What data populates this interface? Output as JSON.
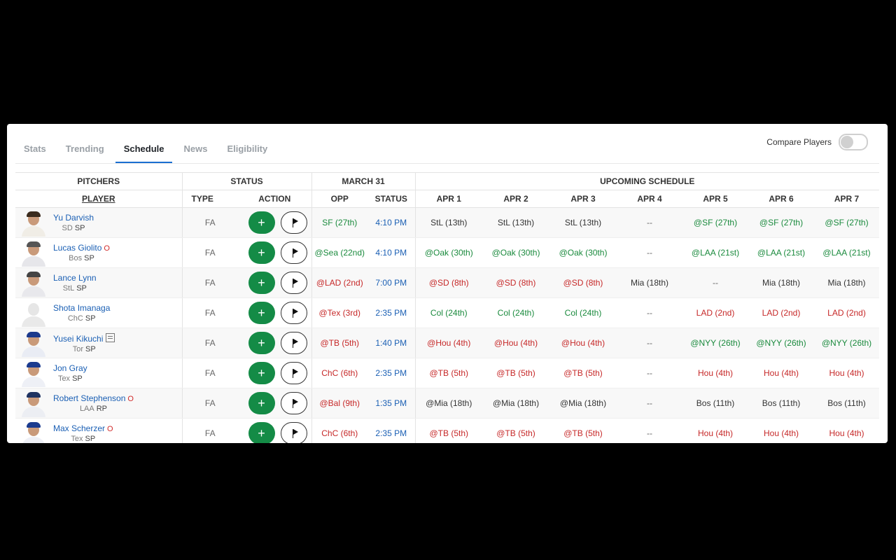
{
  "tabs": [
    "Stats",
    "Trending",
    "Schedule",
    "News",
    "Eligibility"
  ],
  "compare_label": "Compare Players",
  "groups": {
    "pitchers": "PITCHERS",
    "status": "STATUS",
    "march": "MARCH 31",
    "upcoming": "UPCOMING SCHEDULE"
  },
  "cols": {
    "player": "PLAYER",
    "type": "TYPE",
    "action": "ACTION",
    "opp": "OPP",
    "status": "STATUS",
    "days": [
      "APR 1",
      "APR 2",
      "APR 3",
      "APR 4",
      "APR 5",
      "APR 6",
      "APR 7"
    ]
  },
  "add_glyph": "+",
  "players": [
    {
      "name": "Yu Darvish",
      "team": "SD",
      "pos": "SP",
      "type": "FA",
      "inj": "",
      "news": false,
      "cap": "#3a2b1e",
      "jersey": "#f0ede6",
      "opp": "SF (27th)",
      "opp_c": "good",
      "time": "4:10 PM",
      "sched": [
        [
          "StL (13th)",
          "neu"
        ],
        [
          "StL (13th)",
          "neu"
        ],
        [
          "StL (13th)",
          "neu"
        ],
        [
          "--",
          "none"
        ],
        [
          "@SF (27th)",
          "good"
        ],
        [
          "@SF (27th)",
          "good"
        ],
        [
          "@SF (27th)",
          "good"
        ]
      ]
    },
    {
      "name": "Lucas Giolito",
      "team": "Bos",
      "pos": "SP",
      "type": "FA",
      "inj": "O",
      "news": false,
      "cap": "#555555",
      "jersey": "#e6e6ea",
      "opp": "@Sea (22nd)",
      "opp_c": "good",
      "time": "4:10 PM",
      "sched": [
        [
          "@Oak (30th)",
          "good"
        ],
        [
          "@Oak (30th)",
          "good"
        ],
        [
          "@Oak (30th)",
          "good"
        ],
        [
          "--",
          "none"
        ],
        [
          "@LAA (21st)",
          "good"
        ],
        [
          "@LAA (21st)",
          "good"
        ],
        [
          "@LAA (21st)",
          "good"
        ]
      ]
    },
    {
      "name": "Lance Lynn",
      "team": "StL",
      "pos": "SP",
      "type": "FA",
      "inj": "",
      "news": false,
      "cap": "#444444",
      "jersey": "#e8e8ec",
      "opp": "@LAD (2nd)",
      "opp_c": "bad",
      "time": "7:00 PM",
      "sched": [
        [
          "@SD (8th)",
          "bad"
        ],
        [
          "@SD (8th)",
          "bad"
        ],
        [
          "@SD (8th)",
          "bad"
        ],
        [
          "Mia (18th)",
          "neu"
        ],
        [
          "--",
          "none"
        ],
        [
          "Mia (18th)",
          "neu"
        ],
        [
          "Mia (18th)",
          "neu"
        ]
      ]
    },
    {
      "name": "Shota Imanaga",
      "team": "ChC",
      "pos": "SP",
      "type": "FA",
      "inj": "",
      "news": false,
      "blank": true,
      "opp": "@Tex (3rd)",
      "opp_c": "bad",
      "time": "2:35 PM",
      "sched": [
        [
          "Col (24th)",
          "good"
        ],
        [
          "Col (24th)",
          "good"
        ],
        [
          "Col (24th)",
          "good"
        ],
        [
          "--",
          "none"
        ],
        [
          "LAD (2nd)",
          "bad"
        ],
        [
          "LAD (2nd)",
          "bad"
        ],
        [
          "LAD (2nd)",
          "bad"
        ]
      ]
    },
    {
      "name": "Yusei Kikuchi",
      "team": "Tor",
      "pos": "SP",
      "type": "FA",
      "inj": "",
      "news": true,
      "cap": "#1c3a8c",
      "jersey": "#e9ecf4",
      "opp": "@TB (5th)",
      "opp_c": "bad",
      "time": "1:40 PM",
      "sched": [
        [
          "@Hou (4th)",
          "bad"
        ],
        [
          "@Hou (4th)",
          "bad"
        ],
        [
          "@Hou (4th)",
          "bad"
        ],
        [
          "--",
          "none"
        ],
        [
          "@NYY (26th)",
          "good"
        ],
        [
          "@NYY (26th)",
          "good"
        ],
        [
          "@NYY (26th)",
          "good"
        ]
      ]
    },
    {
      "name": "Jon Gray",
      "team": "Tex",
      "pos": "SP",
      "type": "FA",
      "inj": "",
      "news": false,
      "cap": "#1b3b8f",
      "jersey": "#eef0f6",
      "opp": "ChC (6th)",
      "opp_c": "bad",
      "time": "2:35 PM",
      "sched": [
        [
          "@TB (5th)",
          "bad"
        ],
        [
          "@TB (5th)",
          "bad"
        ],
        [
          "@TB (5th)",
          "bad"
        ],
        [
          "--",
          "none"
        ],
        [
          "Hou (4th)",
          "bad"
        ],
        [
          "Hou (4th)",
          "bad"
        ],
        [
          "Hou (4th)",
          "bad"
        ]
      ]
    },
    {
      "name": "Robert Stephenson",
      "team": "LAA",
      "pos": "RP",
      "type": "FA",
      "inj": "O",
      "news": false,
      "cap": "#1f3361",
      "jersey": "#eceef3",
      "opp": "@Bal (9th)",
      "opp_c": "bad",
      "time": "1:35 PM",
      "sched": [
        [
          "@Mia (18th)",
          "neu"
        ],
        [
          "@Mia (18th)",
          "neu"
        ],
        [
          "@Mia (18th)",
          "neu"
        ],
        [
          "--",
          "none"
        ],
        [
          "Bos (11th)",
          "neu"
        ],
        [
          "Bos (11th)",
          "neu"
        ],
        [
          "Bos (11th)",
          "neu"
        ]
      ]
    },
    {
      "name": "Max Scherzer",
      "team": "Tex",
      "pos": "SP",
      "type": "FA",
      "inj": "O",
      "news": false,
      "cap": "#1b3b8f",
      "jersey": "#eef0f6",
      "opp": "ChC (6th)",
      "opp_c": "bad",
      "time": "2:35 PM",
      "sched": [
        [
          "@TB (5th)",
          "bad"
        ],
        [
          "@TB (5th)",
          "bad"
        ],
        [
          "@TB (5th)",
          "bad"
        ],
        [
          "--",
          "none"
        ],
        [
          "Hou (4th)",
          "bad"
        ],
        [
          "Hou (4th)",
          "bad"
        ],
        [
          "Hou (4th)",
          "bad"
        ]
      ]
    }
  ]
}
